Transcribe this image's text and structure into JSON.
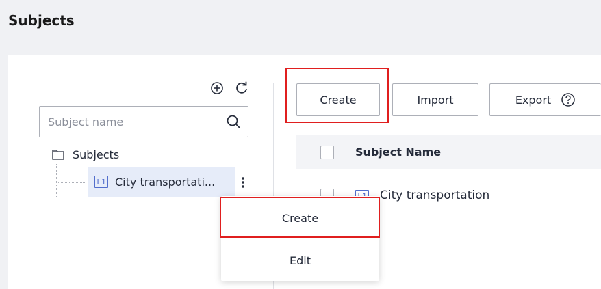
{
  "page": {
    "title": "Subjects"
  },
  "tree": {
    "search_placeholder": "Subject name",
    "root_label": "Subjects",
    "child": {
      "badge": "L1",
      "label": "City transportati..."
    }
  },
  "toolbar": {
    "create_label": "Create",
    "import_label": "Import",
    "export_label": "Export"
  },
  "table": {
    "columns": [
      "Subject Name"
    ],
    "rows": [
      {
        "badge": "L1",
        "name": "City transportation"
      }
    ]
  },
  "context_menu": {
    "items": [
      "Create",
      "Edit"
    ]
  },
  "colors": {
    "highlight": "#e01f1f",
    "badge": "#526ecc",
    "selected_bg": "#e6ecf9"
  },
  "icons": [
    "add-circle-icon",
    "refresh-icon",
    "search-icon",
    "folder-icon",
    "more-vertical-icon",
    "help-icon"
  ]
}
